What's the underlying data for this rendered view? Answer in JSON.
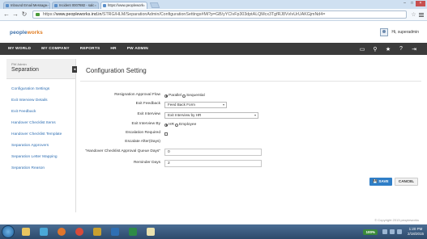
{
  "browser": {
    "tabs": [
      {
        "label": "Inbound Email Message -",
        "active": false
      },
      {
        "label": "Incident 0007882 - salc",
        "active": false
      },
      {
        "label": "https://www.peoplework",
        "active": true
      }
    ],
    "url_scheme": "https://",
    "url_host": "www.peopleworks.ind.in",
    "url_path": "/STRG/HLM/SeparationAdmin/ConfigurationSettings#Mi?p=GB/yYCIvFp303dptALQMcx3TgfRJ8VvIvUrUAKGjmNd4="
  },
  "header": {
    "logo_prefix": "people",
    "logo_suffix": "works",
    "greeting": "Hi, superadmin"
  },
  "nav": {
    "items": [
      "MY WORLD",
      "MY COMPANY",
      "REPORTS",
      "HR",
      "PW ADMIN"
    ]
  },
  "sidebar": {
    "module_caption": "PW Admin",
    "module_title": "Separation",
    "items": [
      {
        "label": "Configuration Settings"
      },
      {
        "label": "Exit Interview Details"
      },
      {
        "label": "Exit Feedback"
      },
      {
        "label": "Handover Checklist Items"
      },
      {
        "label": "Handover Checklist Template"
      },
      {
        "label": "Separation Approvers"
      },
      {
        "label": "Separation Letter Mapping"
      },
      {
        "label": "Separation Reason"
      }
    ]
  },
  "form": {
    "title": "Configuration Setting",
    "resignation_flow": {
      "label": "Resignation Approval Flow",
      "options": [
        "Parallel",
        "Sequential"
      ],
      "selected": "Parallel"
    },
    "exit_feedback": {
      "label": "Exit Feedback",
      "value": "Feed Back Form"
    },
    "exit_interview": {
      "label": "Exit Interview",
      "value": "Exit Interview by HR"
    },
    "exit_interview_by": {
      "label": "Exit Interview By",
      "options": [
        "HR",
        "Employee"
      ],
      "selected": "HR"
    },
    "escalation_required": {
      "label": "Escalation Required",
      "checked": false
    },
    "escalate_after": {
      "label": "Escalate After(Days)"
    },
    "handover_queue": {
      "label": "\"Handover Checklist Approval Queue Days\"",
      "value": "0"
    },
    "reminder_days": {
      "label": "Reminder Days",
      "value": "2"
    },
    "save_label": "SAVE",
    "cancel_label": "CANCEL"
  },
  "footer": {
    "copyright": "© Copyright 2013  peopleworks"
  },
  "taskbar": {
    "zoom": "100%",
    "time": "1:20 PM",
    "date": "2/18/2015"
  }
}
